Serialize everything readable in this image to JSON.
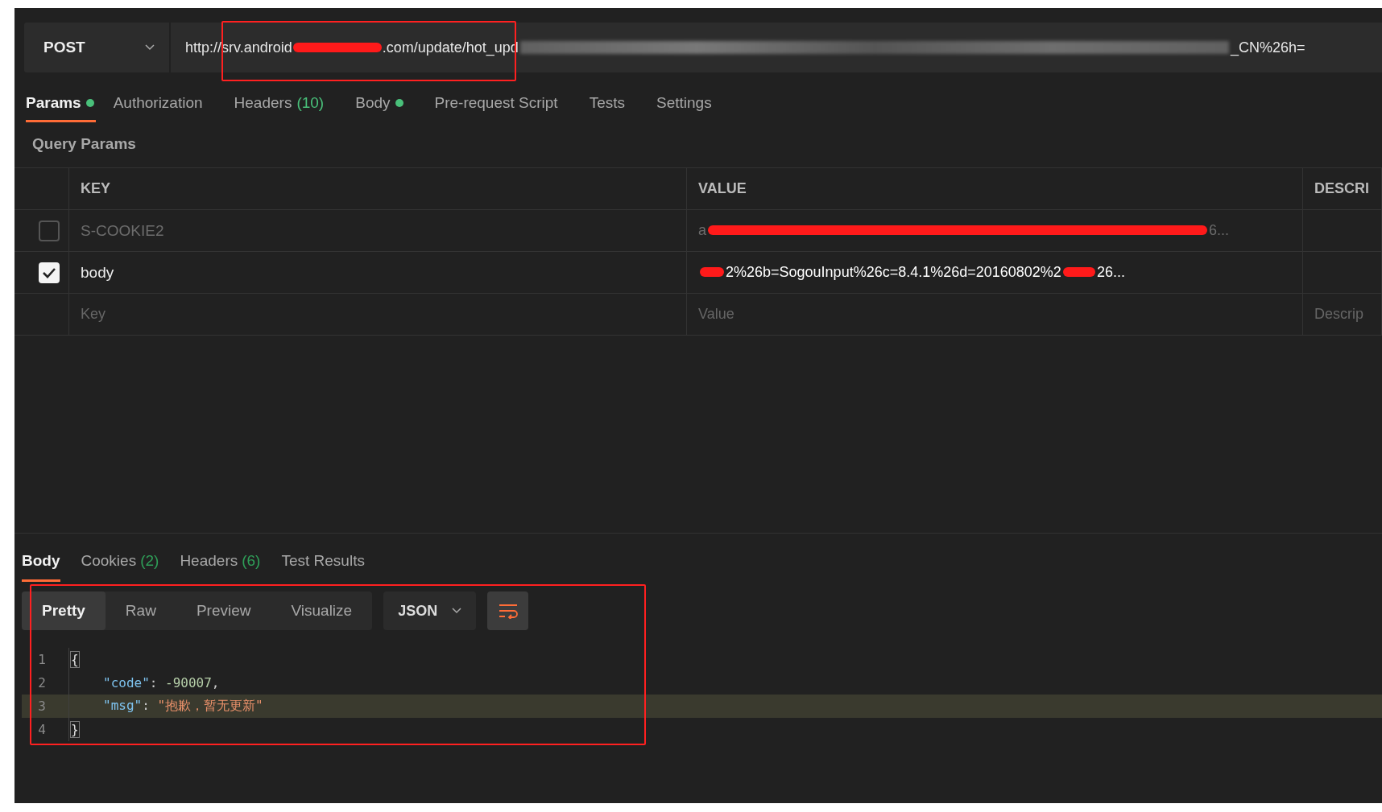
{
  "request": {
    "method": "POST",
    "url_parts": [
      {
        "kind": "text",
        "text": "http://srv.android"
      },
      {
        "kind": "redacted"
      },
      {
        "kind": "text",
        "text": ".com/update/hot_upd"
      },
      {
        "kind": "blurred"
      },
      {
        "kind": "text",
        "text": "_CN%26h="
      }
    ],
    "annotated": true
  },
  "request_tabs": [
    {
      "label": "Params",
      "selected": true,
      "dot": true
    },
    {
      "label": "Authorization",
      "selected": false,
      "dot": false
    },
    {
      "label": "Headers",
      "count": "(10)",
      "selected": false,
      "dot": false
    },
    {
      "label": "Body",
      "selected": false,
      "dot": true
    },
    {
      "label": "Pre-request Script",
      "selected": false,
      "dot": false
    },
    {
      "label": "Tests",
      "selected": false,
      "dot": false
    },
    {
      "label": "Settings",
      "selected": false,
      "dot": false
    }
  ],
  "query_params": {
    "title": "Query Params",
    "columns": [
      "KEY",
      "VALUE",
      "DESCRI"
    ],
    "rows": [
      {
        "checked": false,
        "key": "S-COOKIE2",
        "value_parts": [
          {
            "kind": "text",
            "text": "a"
          },
          {
            "kind": "redacted"
          },
          {
            "kind": "text",
            "text": "6..."
          }
        ]
      },
      {
        "checked": true,
        "key": "body",
        "value_parts": [
          {
            "kind": "redacted"
          },
          {
            "kind": "text",
            "text": "2%26b=SogouInput%26c=8.4.1%26d=20160802%2"
          },
          {
            "kind": "redacted"
          },
          {
            "kind": "text",
            "text": "26..."
          }
        ]
      }
    ],
    "new_row": {
      "key_placeholder": "Key",
      "value_placeholder": "Value",
      "description_placeholder": "Descrip"
    }
  },
  "response": {
    "tabs": [
      {
        "label": "Body",
        "selected": true
      },
      {
        "label": "Cookies",
        "count": "(2)",
        "selected": false
      },
      {
        "label": "Headers",
        "count": "(6)",
        "selected": false
      },
      {
        "label": "Test Results",
        "selected": false
      }
    ],
    "view_modes": [
      {
        "label": "Pretty",
        "selected": true
      },
      {
        "label": "Raw",
        "selected": false
      },
      {
        "label": "Preview",
        "selected": false
      },
      {
        "label": "Visualize",
        "selected": false
      }
    ],
    "format": "JSON",
    "wrap_lines": true,
    "annotated": true,
    "lines": [
      {
        "number": "1",
        "highlighted": false,
        "tokens": [
          {
            "kind": "bracket",
            "text": "{"
          }
        ]
      },
      {
        "number": "2",
        "highlighted": false,
        "tokens": [
          {
            "kind": "key",
            "text": "\"code\""
          },
          {
            "kind": "punct",
            "text": ": "
          },
          {
            "kind": "number",
            "text": "-90007"
          },
          {
            "kind": "punct",
            "text": ","
          }
        ]
      },
      {
        "number": "3",
        "highlighted": true,
        "tokens": [
          {
            "kind": "key",
            "text": "\"msg\""
          },
          {
            "kind": "punct",
            "text": ": "
          },
          {
            "kind": "string",
            "text": "\"抱歉，暂无更新\""
          }
        ]
      },
      {
        "number": "4",
        "highlighted": false,
        "tokens": [
          {
            "kind": "bracket",
            "text": "}"
          }
        ]
      }
    ]
  }
}
